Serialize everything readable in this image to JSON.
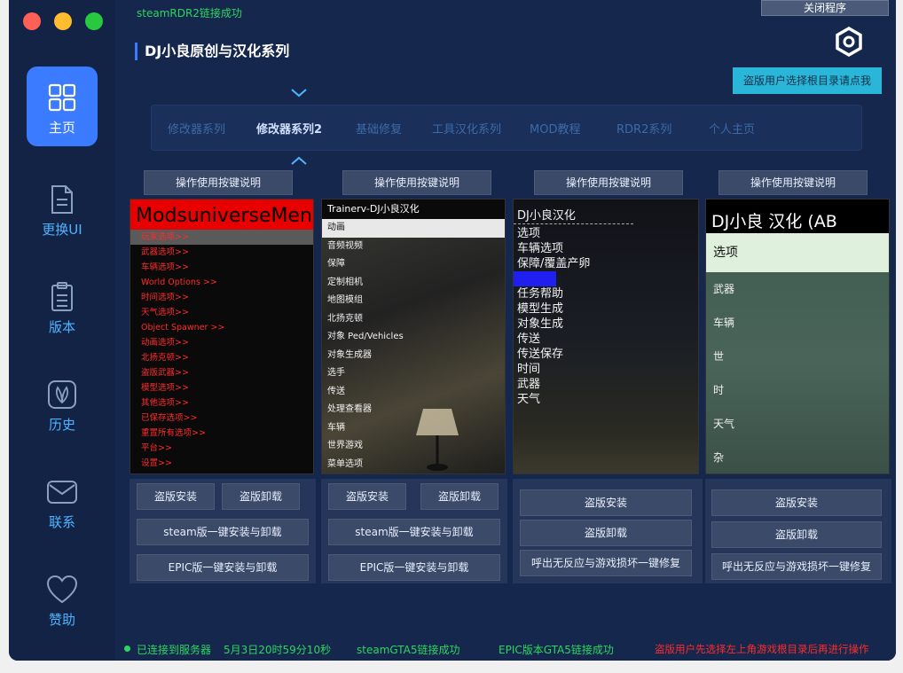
{
  "window": {
    "traffic_colors": [
      "#fe5f57",
      "#febc2e",
      "#28c840"
    ]
  },
  "sidebar": {
    "items": [
      {
        "label": "主页",
        "icon": "grid-icon",
        "active": true
      },
      {
        "label": "更换UI",
        "icon": "document-icon"
      },
      {
        "label": "版本",
        "icon": "clipboard-icon"
      },
      {
        "label": "历史",
        "icon": "leaf-icon"
      },
      {
        "label": "联系",
        "icon": "mail-icon"
      },
      {
        "label": "赞助",
        "icon": "heart-icon"
      }
    ]
  },
  "header": {
    "status": "steamRDR2链接成功",
    "close_label": "关闭程序",
    "title": "DJ小良原创与汉化系列",
    "notice_label": "盗版用户选择根目录请点我"
  },
  "tabs": [
    {
      "label": "修改器系列"
    },
    {
      "label": "修改器系列2"
    },
    {
      "label": "基础修复"
    },
    {
      "label": "工具汉化系列"
    },
    {
      "label": "MOD教程"
    },
    {
      "label": "RDR2系列"
    },
    {
      "label": "个人主页"
    }
  ],
  "columns": [
    {
      "help_label": "操作使用按键说明",
      "panel_title": "ModsuniverseMenu",
      "menu": [
        "玩家选项>>",
        "武器选项>>",
        "车辆选项>>",
        "World Options >>",
        "时间选项>>",
        "天气选项>>",
        "Object Spawner >>",
        "动画选项>>",
        "北扬克顿>>",
        "盗版武器>>",
        "模型选项>>",
        "其他选项>>",
        "已保存选项>>",
        "重置所有选项>>",
        "平台>>",
        "设置>>"
      ],
      "pirate_install": "盗版安装",
      "pirate_uninstall": "盗版卸载",
      "steam_label": "steam版一键安装与卸载",
      "epic_label": "EPIC版一键安装与卸载"
    },
    {
      "help_label": "操作使用按键说明",
      "panel_title": "Trainerv-DJ小良汉化",
      "menu": [
        "动画",
        "音频视频",
        "保障",
        "定制相机",
        "地图模组",
        "北扬克顿",
        "对象 Ped/Vehicles",
        "对象生成器",
        "选手",
        "传送",
        "处理查看器",
        "车辆",
        "世界游戏",
        "菜单选项"
      ],
      "pirate_install": "盗版安装",
      "pirate_uninstall": "盗版卸载",
      "steam_label": "steam版一键安装与卸载",
      "epic_label": "EPIC版一键安装与卸载"
    },
    {
      "help_label": "操作使用按键说明",
      "panel_title": "DJ小良汉化",
      "menu": [
        "选项",
        "车辆选项",
        "保障/覆盖产卵",
        "",
        "任务帮助",
        "模型生成",
        "对象生成",
        "传送",
        "传送保存",
        "时间",
        "武器",
        "天气"
      ],
      "pirate_install": "盗版安装",
      "pirate_uninstall": "盗版卸载",
      "fix_label": "呼出无反应与游戏损坏一键修复"
    },
    {
      "help_label": "操作使用按键说明",
      "panel_title": "DJ小良 汉化 (AB",
      "menu": [
        "选项",
        "武器",
        "车辆",
        "世",
        "时",
        "天气",
        "杂"
      ],
      "pirate_install": "盗版安装",
      "pirate_uninstall": "盗版卸载",
      "fix_label": "呼出无反应与游戏损坏一键修复"
    }
  ],
  "footer": {
    "connected": "已连接到服务器",
    "datetime": "5月3日20时59分10秒",
    "steam_status": "steamGTA5链接成功",
    "epic_status": "EPIC版本GTA5链接成功",
    "warning": "盗版用户先选择左上角游戏根目录后再进行操作"
  }
}
